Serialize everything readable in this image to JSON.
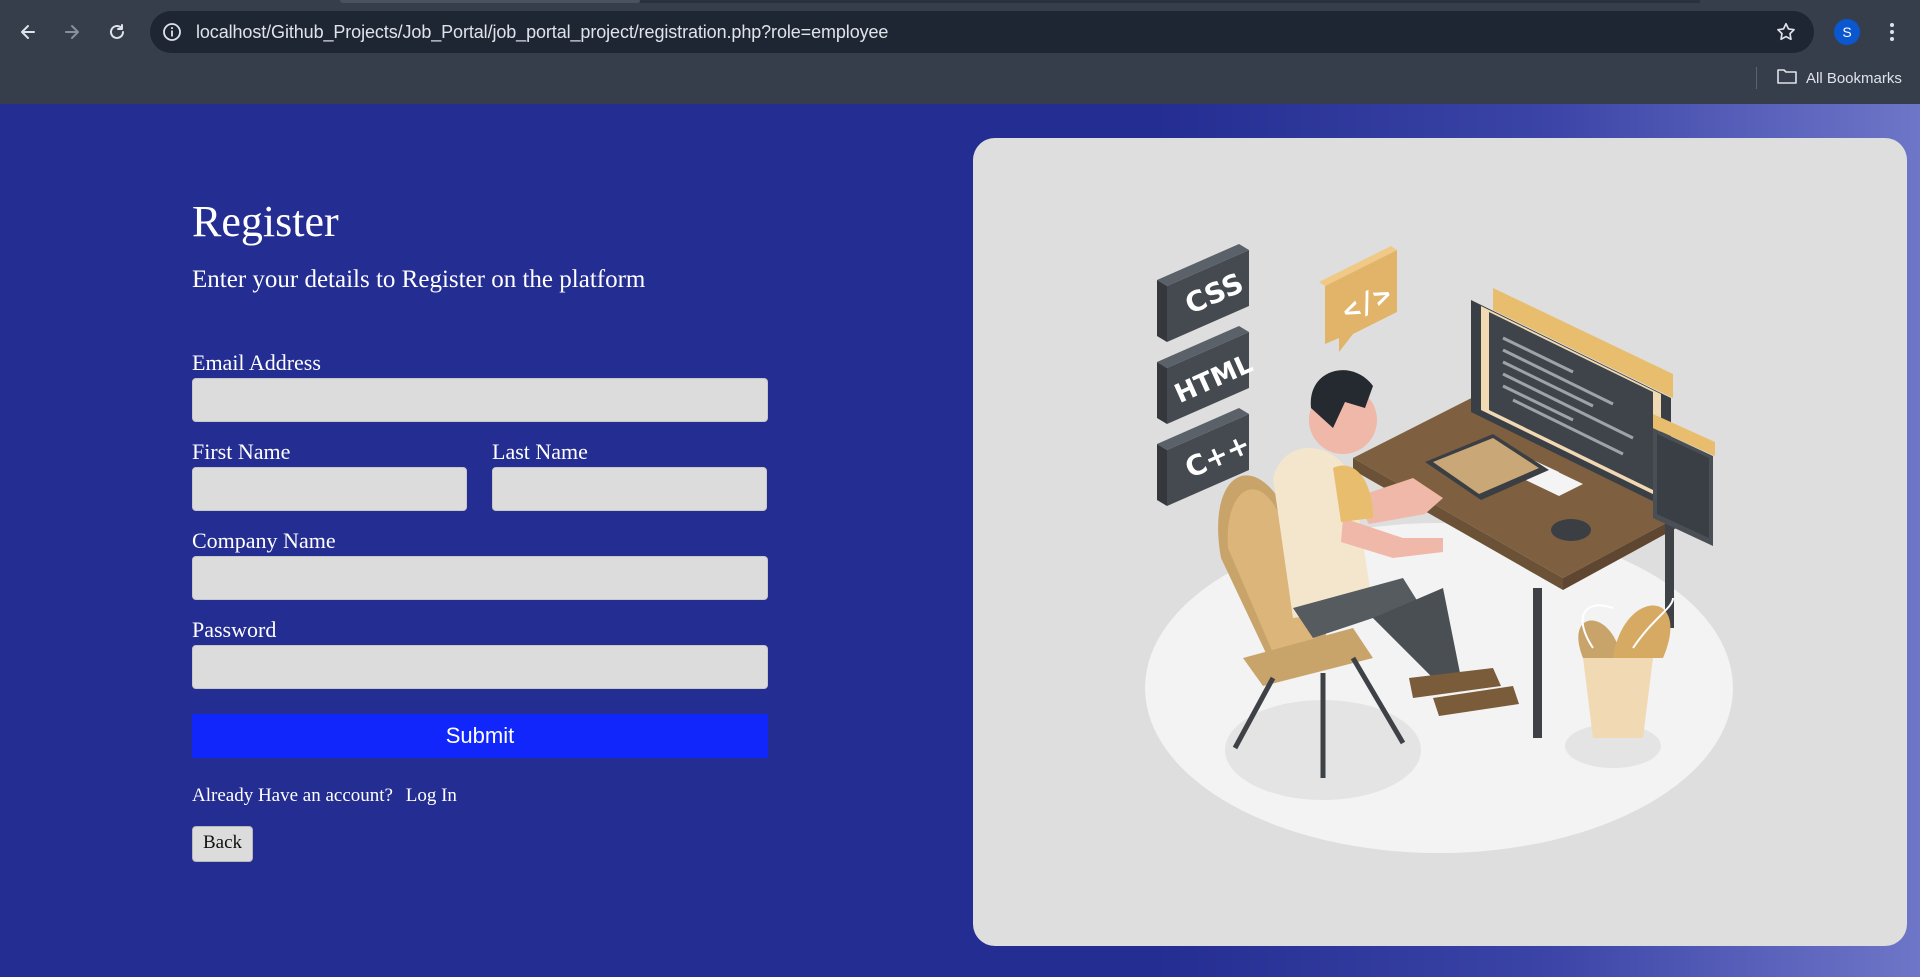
{
  "browser": {
    "url": "localhost/Github_Projects/Job_Portal/job_portal_project/registration.php?role=employee",
    "profile_initial": "S",
    "bookmarks_label": "All Bookmarks"
  },
  "form": {
    "title": "Register",
    "subtitle": "Enter your details to Register on the platform",
    "email_label": "Email Address",
    "first_name_label": "First Name",
    "last_name_label": "Last Name",
    "company_label": "Company Name",
    "password_label": "Password",
    "submit_label": "Submit",
    "account_prompt": "Already Have an account?",
    "login_link": "Log In",
    "back_label": "Back"
  },
  "illustration": {
    "badges": [
      "CSS",
      "HTML",
      "C++"
    ],
    "code_bubble": "</>"
  }
}
